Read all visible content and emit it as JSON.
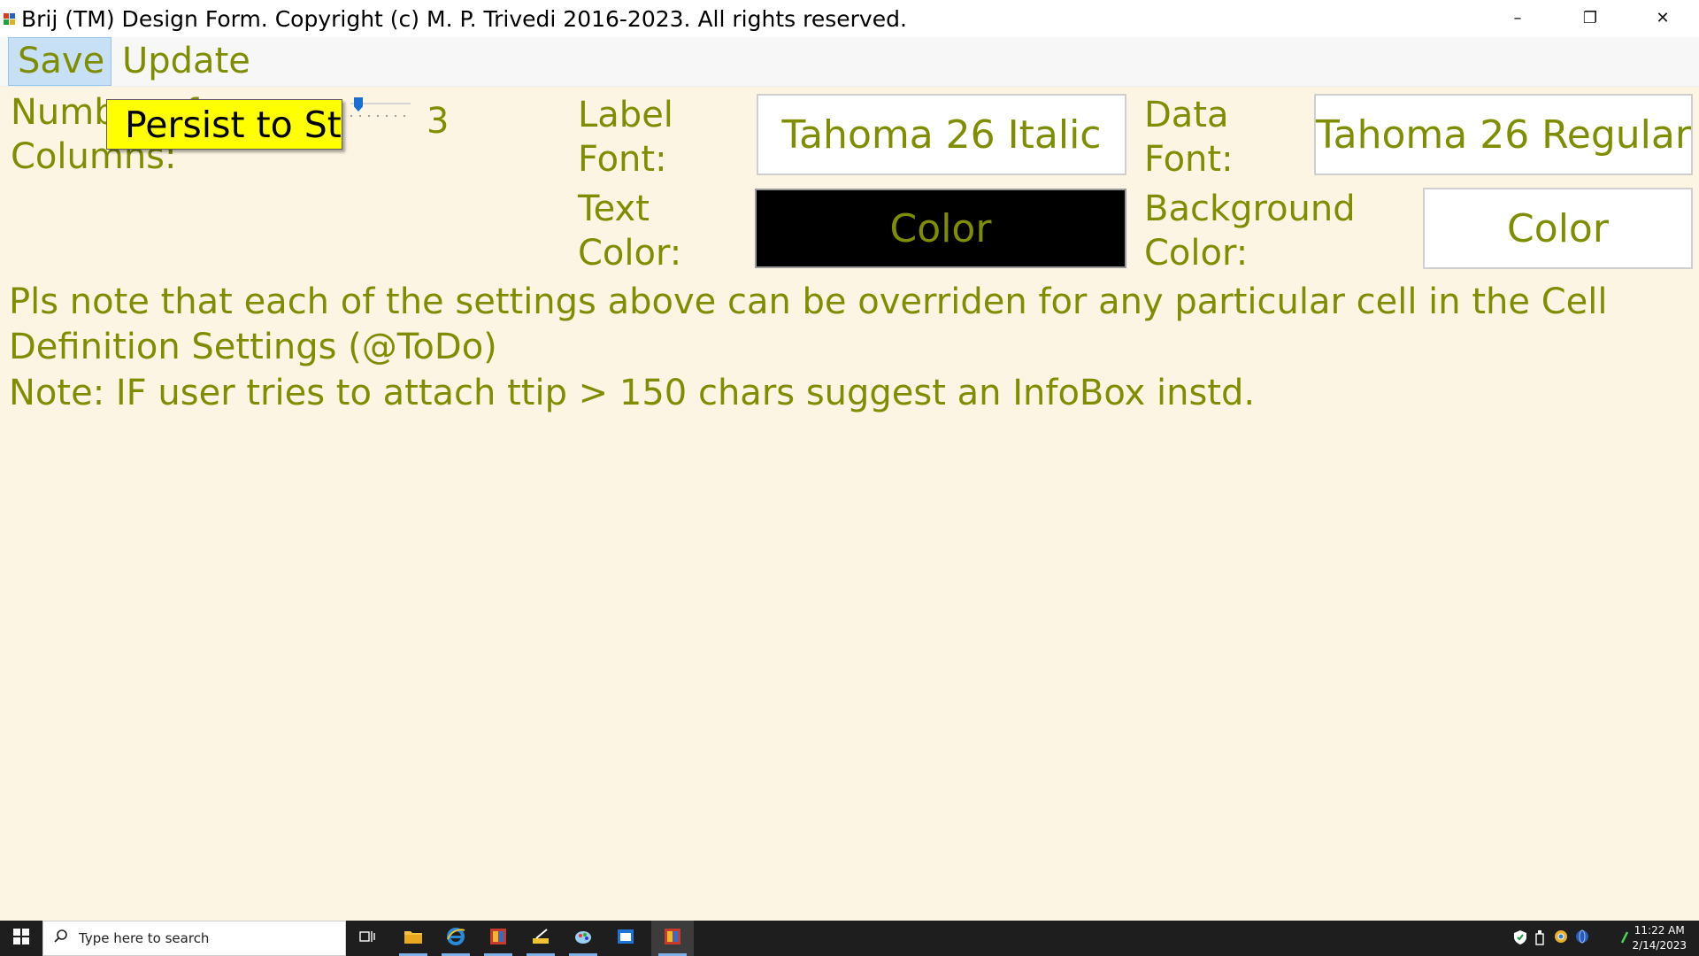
{
  "window": {
    "title": "Brij (TM) Design Form. Copyright (c) M. P. Trivedi 2016-2023.  All rights reserved.",
    "controls": {
      "minimize": "–",
      "restore": "❐",
      "close": "✕"
    }
  },
  "menu": {
    "save": "Save",
    "update": "Update"
  },
  "form": {
    "columns_label": "Number of\nColumns:",
    "columns_value": "3",
    "columns_slider_level": 0.1,
    "label_font_label": "Label\nFont:",
    "label_font_value": "Tahoma 26 Italic",
    "data_font_label": "Data\nFont:",
    "data_font_value": "Tahoma 26 Regular",
    "text_color_label": "Text\nColor:",
    "text_color_button": "Color",
    "background_color_label": "Background\nColor:",
    "background_color_button": "Color"
  },
  "tooltip": {
    "text": "Persist to St"
  },
  "notes": {
    "line1": "Pls note that each of the settings above can be overriden for any particular cell in the Cell",
    "line2": "Definition Settings (@ToDo)",
    "line3": "Note: IF user tries to attach ttip > 150 chars suggest an InfoBox instd."
  },
  "taskbar": {
    "search_placeholder": "Type here to search",
    "clock_time": "11:22 AM",
    "clock_date": "2/14/2023"
  },
  "colors": {
    "accent_text": "#7f8e00",
    "form_background": "#fcf5e3",
    "tooltip_background": "#ffff00",
    "text_color_swatch": "#000000"
  }
}
